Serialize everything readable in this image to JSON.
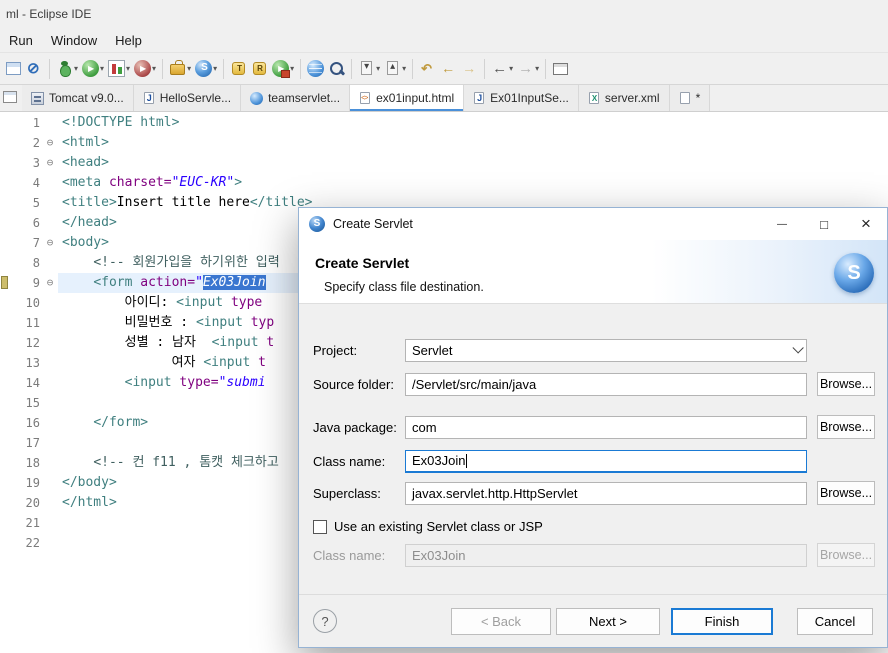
{
  "window": {
    "title": "ml - Eclipse IDE"
  },
  "menu": {
    "items": [
      "Run",
      "Window",
      "Help"
    ]
  },
  "toolbar": {
    "items": [
      {
        "name": "table-icon"
      },
      {
        "name": "skip-breakpoints-icon"
      },
      {
        "sep": true
      },
      {
        "name": "debug-icon",
        "dropdown": true
      },
      {
        "name": "run-icon",
        "dropdown": true
      },
      {
        "name": "coverage-icon",
        "dropdown": true
      },
      {
        "name": "profile-icon",
        "dropdown": true
      },
      {
        "sep": true
      },
      {
        "name": "new-wizard-icon",
        "dropdown": true
      },
      {
        "name": "servlet-wizard-icon",
        "dropdown": true
      },
      {
        "sep": true
      },
      {
        "name": "open-type-icon"
      },
      {
        "name": "open-resource-icon"
      },
      {
        "name": "external-tools-icon",
        "dropdown": true
      },
      {
        "sep": true
      },
      {
        "name": "browser-icon"
      },
      {
        "name": "search-icon"
      },
      {
        "sep": true
      },
      {
        "name": "annotation-next-icon",
        "dropdown": true
      },
      {
        "name": "annotation-prev-icon",
        "dropdown": true
      },
      {
        "sep": true
      },
      {
        "name": "last-edit-icon"
      },
      {
        "name": "previous-edit-icon"
      },
      {
        "name": "next-edit-icon"
      },
      {
        "sep": true
      },
      {
        "name": "nav-back-icon",
        "dropdown": true
      },
      {
        "name": "nav-forward-icon",
        "dropdown": true
      },
      {
        "sep": true
      },
      {
        "name": "new-editor-icon"
      }
    ]
  },
  "tabs": [
    {
      "label": "Tomcat v9.0...",
      "icon": "server-icon"
    },
    {
      "label": "HelloServle...",
      "icon": "java-file-icon"
    },
    {
      "label": "teamservlet...",
      "icon": "web-file-icon"
    },
    {
      "label": "ex01input.html",
      "icon": "html-file-icon",
      "active": true
    },
    {
      "label": "Ex01InputSe...",
      "icon": "java-file-icon"
    },
    {
      "label": "server.xml",
      "icon": "xml-file-icon"
    },
    {
      "label": "*",
      "icon": "file-icon"
    }
  ],
  "editor": {
    "lines": [
      {
        "num": "1",
        "segs": [
          {
            "s": "tag",
            "t": "<!DOCTYPE html>"
          }
        ]
      },
      {
        "num": "2",
        "fold": true,
        "segs": [
          {
            "s": "tag",
            "t": "<html>"
          }
        ]
      },
      {
        "num": "3",
        "fold": true,
        "segs": [
          {
            "s": "tag",
            "t": "<head>"
          }
        ]
      },
      {
        "num": "4",
        "segs": [
          {
            "s": "tag",
            "t": "<meta "
          },
          {
            "s": "attr",
            "t": "charset="
          },
          {
            "s": "val",
            "t": "\"EUC-KR\""
          },
          {
            "s": "tag",
            "t": ">"
          }
        ]
      },
      {
        "num": "5",
        "segs": [
          {
            "s": "tag",
            "t": "<title>"
          },
          {
            "s": "text",
            "t": "Insert title here"
          },
          {
            "s": "tag",
            "t": "</title>"
          }
        ]
      },
      {
        "num": "6",
        "segs": [
          {
            "s": "tag",
            "t": "</head>"
          }
        ]
      },
      {
        "num": "7",
        "fold": true,
        "segs": [
          {
            "s": "tag",
            "t": "<body>"
          }
        ]
      },
      {
        "num": "8",
        "segs": [
          {
            "s": "text",
            "t": "    "
          },
          {
            "s": "comment",
            "t": "<!-- 회원가입을 하기위한 입력"
          }
        ]
      },
      {
        "num": "9",
        "fold": true,
        "current": true,
        "marker": true,
        "segs": [
          {
            "s": "text",
            "t": "    "
          },
          {
            "s": "tag",
            "t": "<form "
          },
          {
            "s": "attr",
            "t": "action="
          },
          {
            "s": "val",
            "t": "\""
          },
          {
            "s": "sel",
            "t": "Ex03Join"
          }
        ]
      },
      {
        "num": "10",
        "segs": [
          {
            "s": "text",
            "t": "        아이디: "
          },
          {
            "s": "tag",
            "t": "<input "
          },
          {
            "s": "attr",
            "t": "type"
          }
        ]
      },
      {
        "num": "11",
        "segs": [
          {
            "s": "text",
            "t": "        비밀번호 : "
          },
          {
            "s": "tag",
            "t": "<input "
          },
          {
            "s": "attr",
            "t": "typ"
          }
        ]
      },
      {
        "num": "12",
        "segs": [
          {
            "s": "text",
            "t": "        성별 : 남자  "
          },
          {
            "s": "tag",
            "t": "<input "
          },
          {
            "s": "attr",
            "t": "t"
          }
        ]
      },
      {
        "num": "13",
        "segs": [
          {
            "s": "text",
            "t": "              여자 "
          },
          {
            "s": "tag",
            "t": "<input "
          },
          {
            "s": "attr",
            "t": "t"
          }
        ]
      },
      {
        "num": "14",
        "segs": [
          {
            "s": "text",
            "t": "        "
          },
          {
            "s": "tag",
            "t": "<input "
          },
          {
            "s": "attr",
            "t": "type="
          },
          {
            "s": "val",
            "t": "\"submi"
          }
        ]
      },
      {
        "num": "15",
        "segs": []
      },
      {
        "num": "16",
        "segs": [
          {
            "s": "text",
            "t": "    "
          },
          {
            "s": "tag",
            "t": "</form>"
          }
        ]
      },
      {
        "num": "17",
        "segs": []
      },
      {
        "num": "18",
        "segs": [
          {
            "s": "text",
            "t": "    "
          },
          {
            "s": "comment",
            "t": "<!-- 컨 f11 , 톰캣 체크하고"
          }
        ]
      },
      {
        "num": "19",
        "segs": [
          {
            "s": "tag",
            "t": "</body>"
          }
        ]
      },
      {
        "num": "20",
        "segs": [
          {
            "s": "tag",
            "t": "</html>"
          }
        ]
      },
      {
        "num": "21",
        "segs": []
      },
      {
        "num": "22",
        "segs": []
      }
    ]
  },
  "dialog": {
    "title": "Create Servlet",
    "icon_letter": "S",
    "header": {
      "title": "Create Servlet",
      "subtitle": "Specify class file destination."
    },
    "fields": {
      "project_label": "Project:",
      "project_value": "Servlet",
      "source_folder_label": "Source folder:",
      "source_folder_value": "/Servlet/src/main/java",
      "java_package_label": "Java package:",
      "java_package_value": "com",
      "class_name_label": "Class name:",
      "class_name_value": "Ex03Join",
      "superclass_label": "Superclass:",
      "superclass_value": "javax.servlet.http.HttpServlet",
      "browse_label": "Browse...",
      "use_existing_label": "Use an existing Servlet class or JSP",
      "existing_class_label": "Class name:",
      "existing_class_value": "Ex03Join"
    },
    "buttons": {
      "help": "?",
      "back": "< Back",
      "next": "Next >",
      "finish": "Finish",
      "cancel": "Cancel"
    }
  }
}
